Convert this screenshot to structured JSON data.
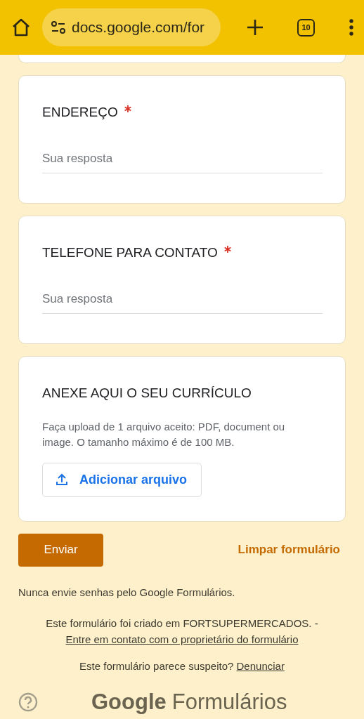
{
  "browser": {
    "url": "docs.google.com/for",
    "tab_count": "10"
  },
  "questions": [
    {
      "kind": "text",
      "title": "ENDEREÇO",
      "required": true,
      "placeholder": "Sua resposta"
    },
    {
      "kind": "text",
      "title": "TELEFONE PARA CONTATO",
      "required": true,
      "placeholder": "Sua resposta"
    },
    {
      "kind": "file",
      "title": "ANEXE AQUI O SEU CURRÍCULO",
      "required": false,
      "hint": "Faça upload de 1 arquivo aceito: PDF, document ou image. O tamanho máximo é de 100 MB.",
      "button": "Adicionar arquivo"
    }
  ],
  "submit": "Enviar",
  "clear": "Limpar formulário",
  "notice": "Nunca envie senhas pelo Google Formulários.",
  "footer": {
    "created_text": "Este formulário foi criado em FORTSUPERMERCADOS. -",
    "contact_link": "Entre em contato com o proprietário do formulário",
    "suspicious_text": "Este formulário parece suspeito?",
    "report_link": "Denunciar"
  },
  "brand": {
    "google": "Google",
    "product": "Formulários"
  }
}
